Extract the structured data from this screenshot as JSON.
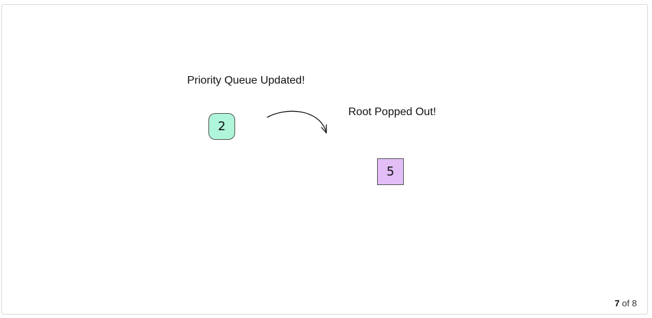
{
  "diagram": {
    "pq_label": "Priority Queue Updated!",
    "popped_label": "Root Popped Out!",
    "queue_node": {
      "value": "2",
      "color": "#aef5d9"
    },
    "popped_node": {
      "value": "5",
      "color": "#e2bdf6"
    },
    "arrow_icon": "curved-arrow-icon"
  },
  "pagination": {
    "current": "7",
    "separator": "of",
    "total": "8"
  }
}
